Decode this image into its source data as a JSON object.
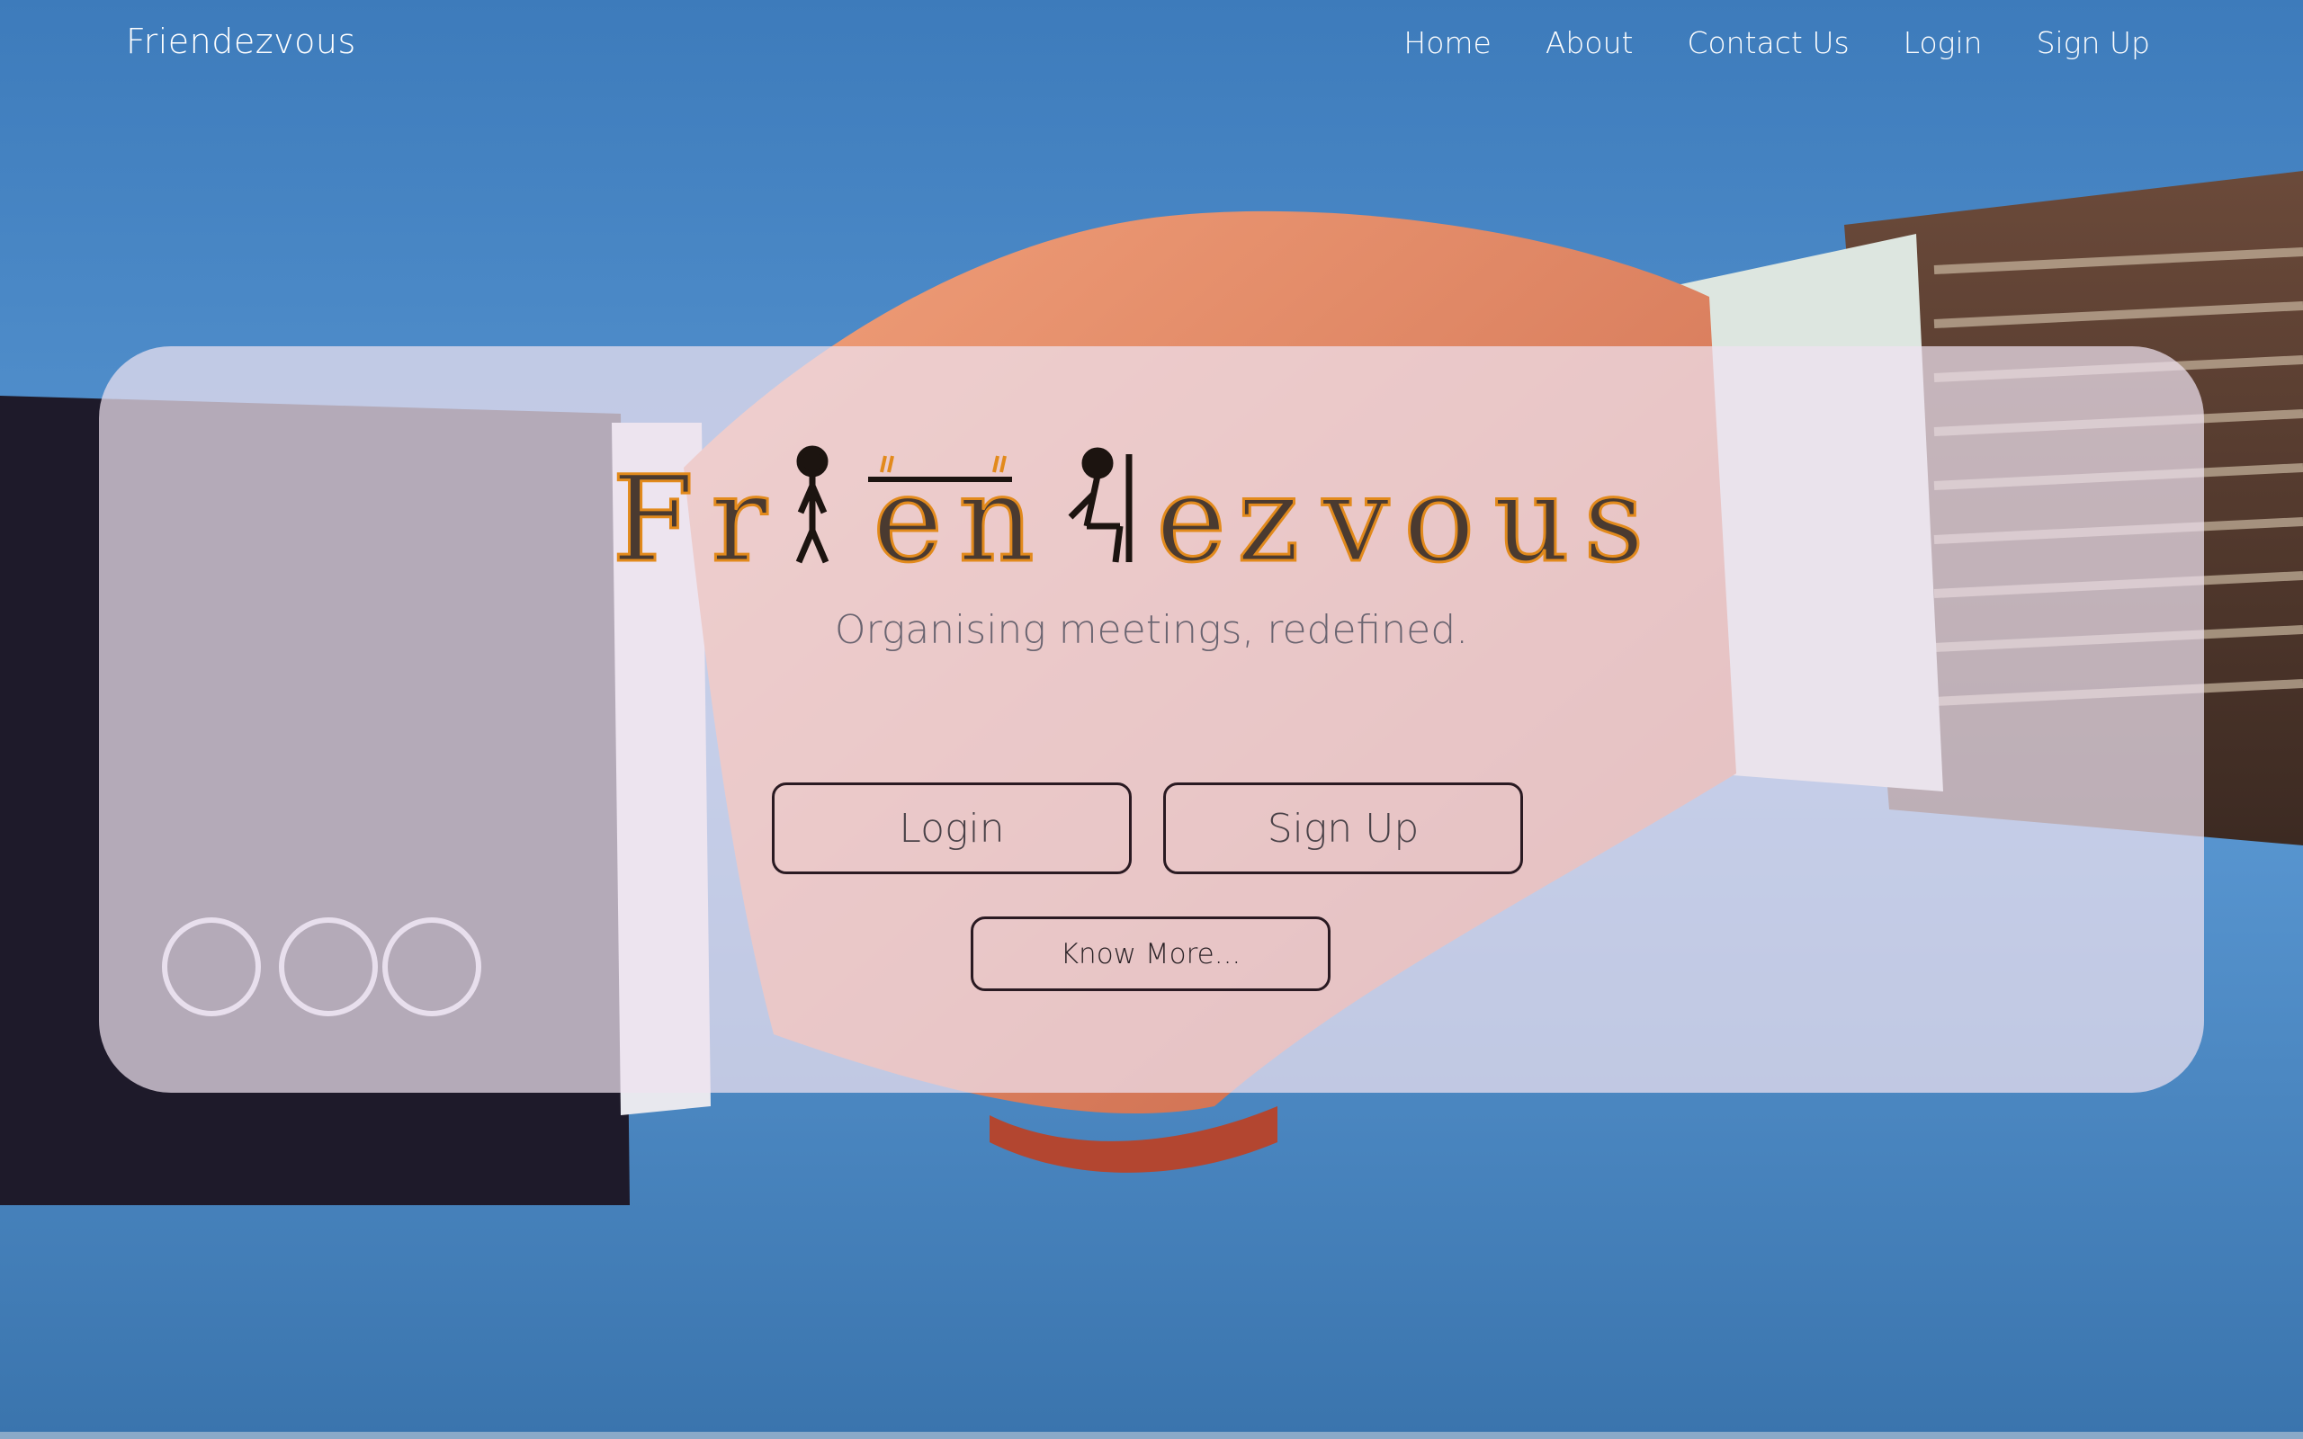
{
  "nav": {
    "brand": "Friendezvous",
    "items": [
      {
        "label": "Home"
      },
      {
        "label": "About"
      },
      {
        "label": "Contact Us"
      },
      {
        "label": "Login"
      },
      {
        "label": "Sign Up"
      }
    ]
  },
  "hero": {
    "logo_text": "Friendezvous",
    "tagline": "Organising meetings, redefined.",
    "login_label": "Login",
    "signup_label": "Sign Up",
    "know_more_label": "Know More..."
  },
  "colors": {
    "logo_outline": "#e28a1c",
    "logo_fill": "#4a3a30",
    "button_border": "#2a1a22"
  },
  "icons": [
    "handshake-illustration",
    "standing-figure-icon",
    "seated-figure-icon",
    "table-icon"
  ]
}
